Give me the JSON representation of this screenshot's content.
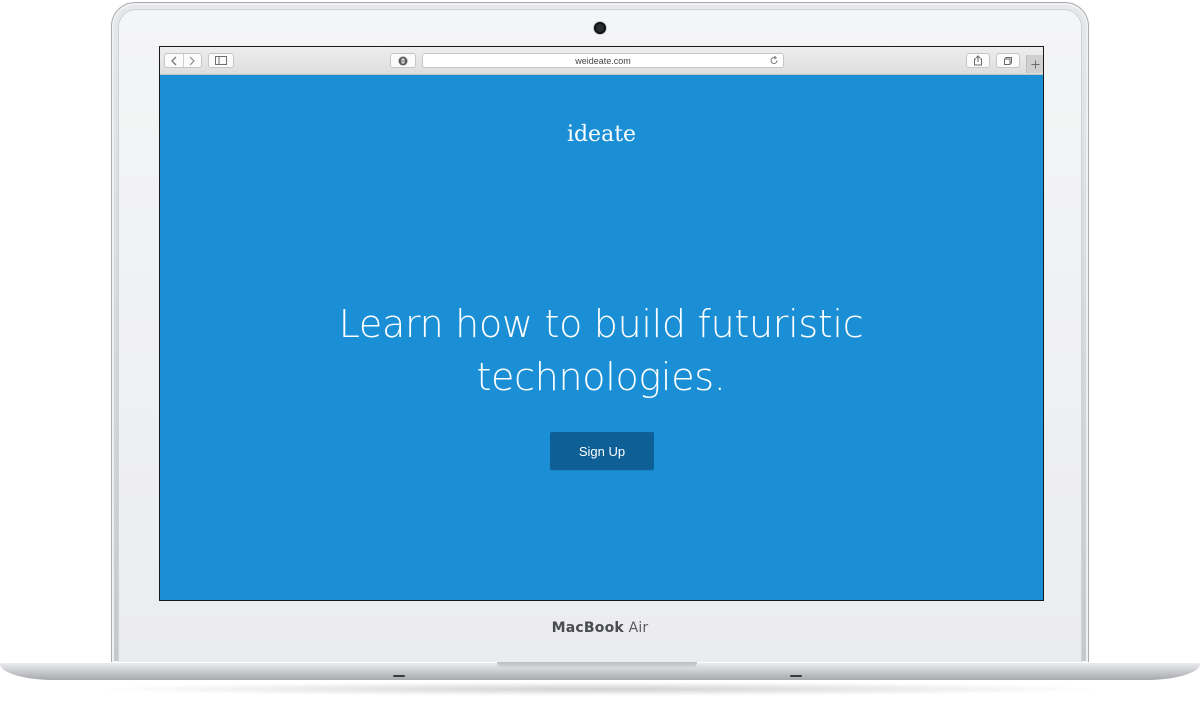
{
  "device": {
    "brand_bold": "MacBook",
    "brand_regular": "Air"
  },
  "browser": {
    "url": "weideate.com",
    "icons": {
      "back": "chevron-left-icon",
      "forward": "chevron-right-icon",
      "sidebar": "sidebar-icon",
      "reader": "reader-icon",
      "reload": "reload-icon",
      "share": "share-icon",
      "tabs": "tabs-icon",
      "new_tab": "plus-icon"
    }
  },
  "site": {
    "logo": "ideate",
    "headline_line1": "Learn how to build futuristic",
    "headline_line2": "technologies.",
    "cta_label": "Sign Up",
    "colors": {
      "background": "#1a8fd6",
      "button": "#0d5f96",
      "text": "#ffffff"
    }
  }
}
